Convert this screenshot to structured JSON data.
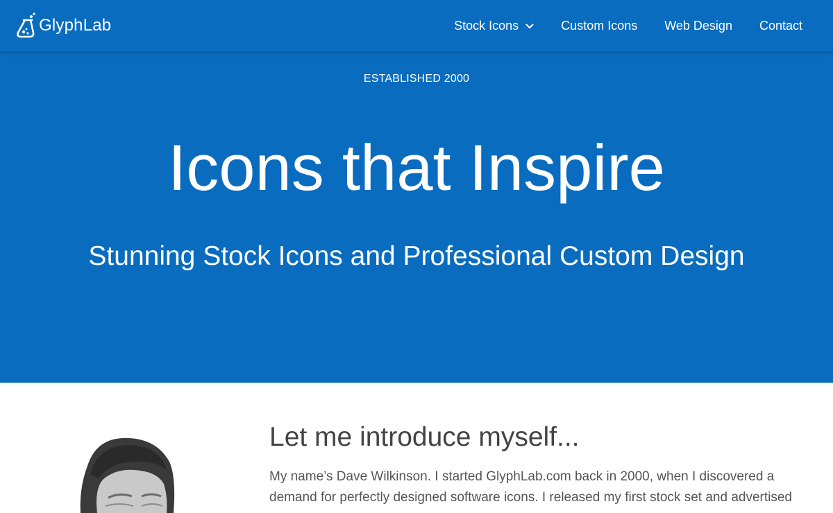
{
  "brand": {
    "name": "GlyphLab",
    "accent_color": "#096cbf",
    "logo_icon": "flask-icon"
  },
  "nav": {
    "items": [
      {
        "label": "Stock Icons",
        "has_dropdown": true,
        "icon": "chevron-down-icon"
      },
      {
        "label": "Custom Icons"
      },
      {
        "label": "Web Design"
      },
      {
        "label": "Contact"
      }
    ]
  },
  "hero": {
    "eyebrow": "ESTABLISHED 2000",
    "title": "Icons that Inspire",
    "subtitle": "Stunning Stock Icons and Professional Custom Design"
  },
  "intro": {
    "heading": "Let me introduce myself...",
    "body": "My name’s Dave Wilkinson. I started GlyphLab.com back in 2000, when I discovered a demand for perfectly designed software icons. I released my first stock set and advertised"
  }
}
